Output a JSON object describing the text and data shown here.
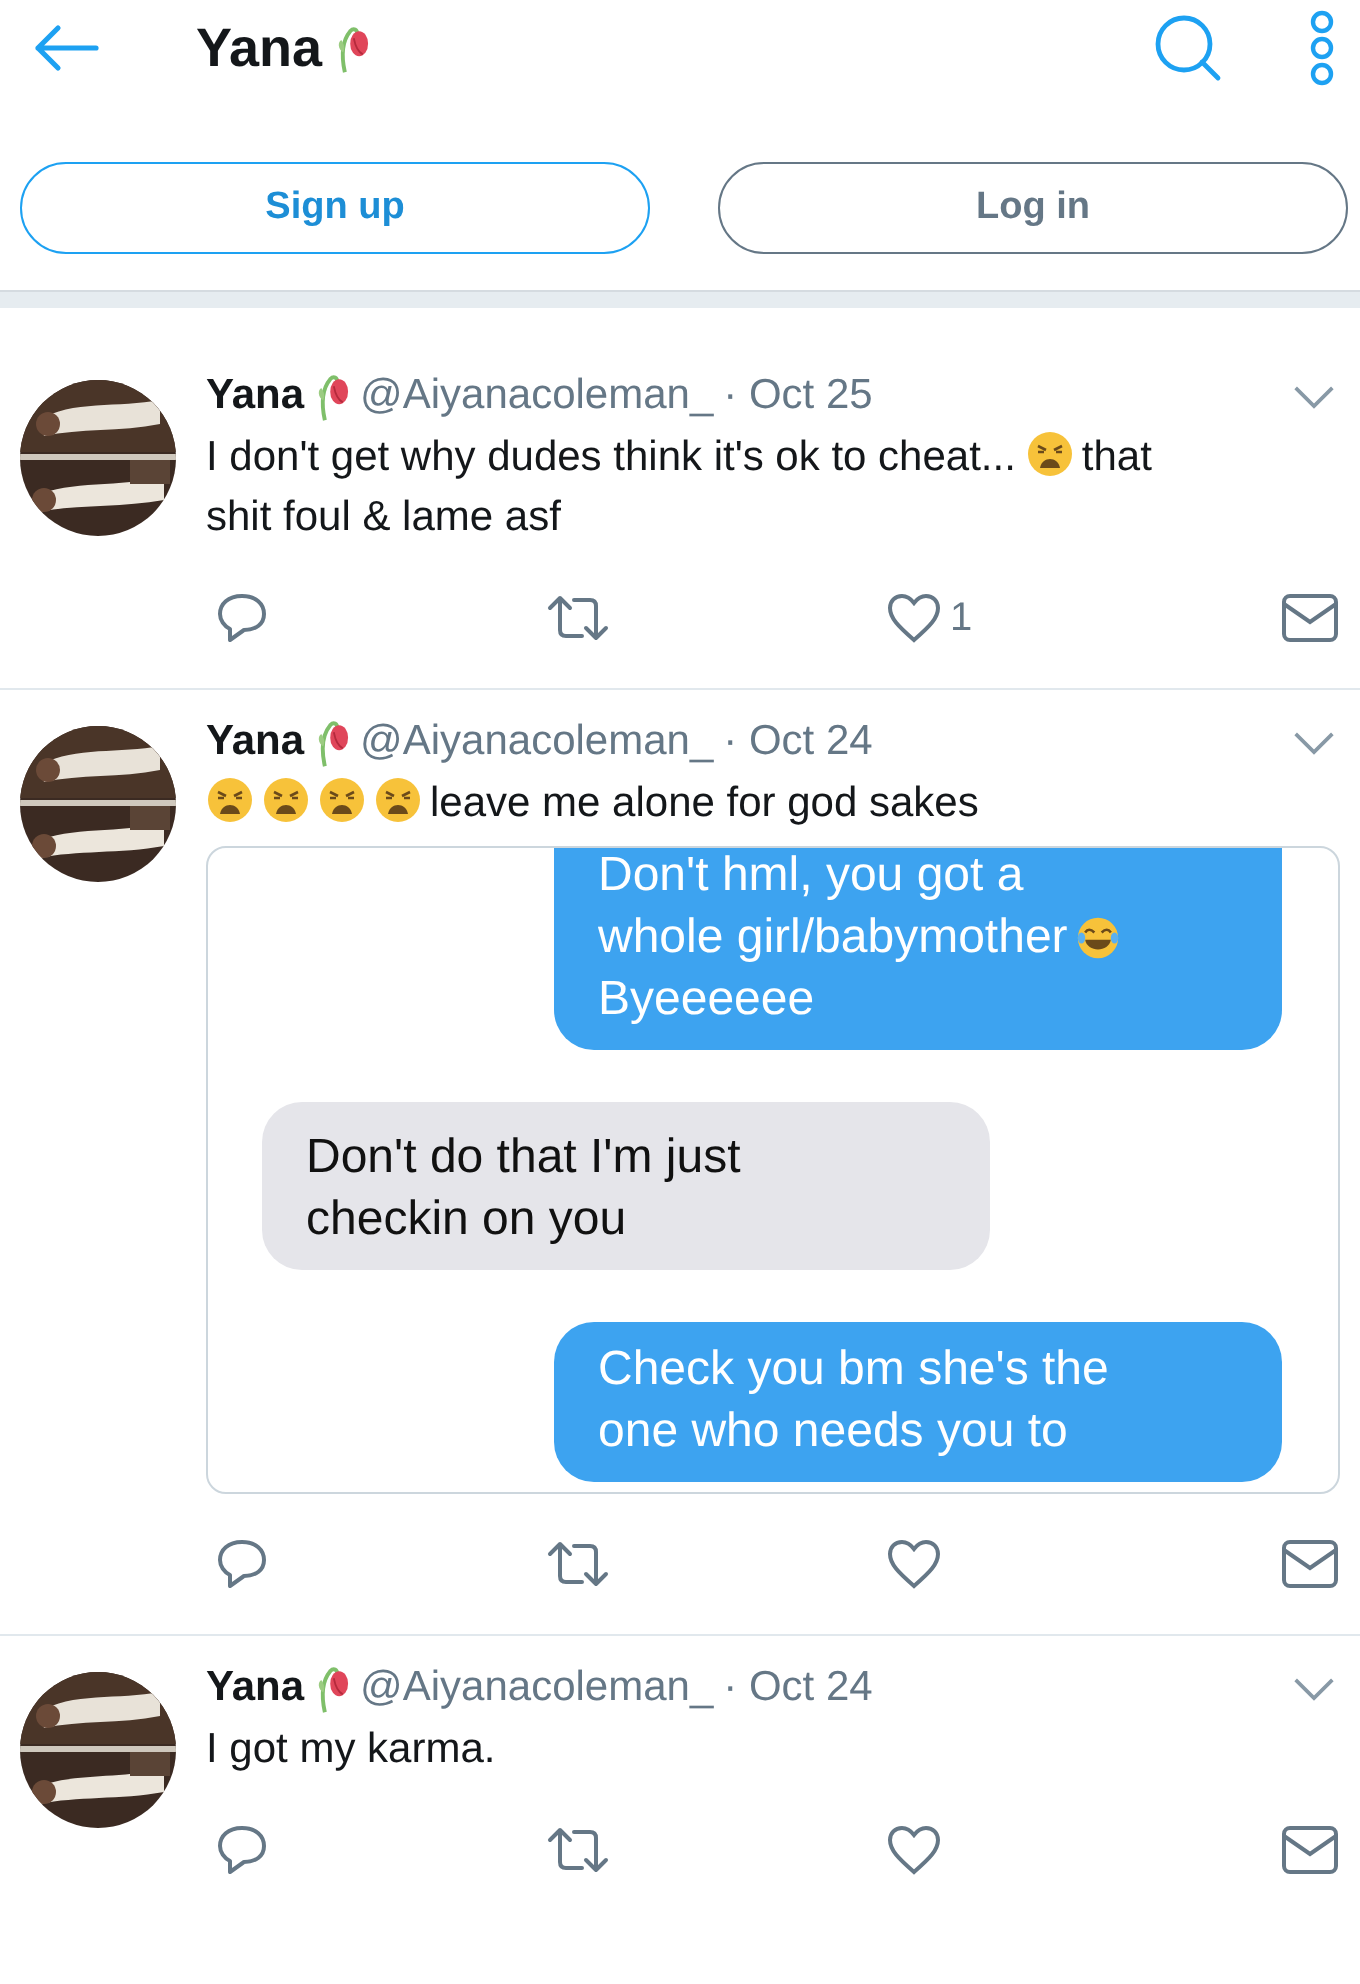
{
  "header": {
    "title": "Yana"
  },
  "buttons": [
    {
      "label": "Sign up",
      "kind": "primary"
    },
    {
      "label": "Log in",
      "kind": "secondary"
    }
  ],
  "tweets": [
    {
      "name": "Yana",
      "handle": "@Aiyanacoleman_",
      "date": "· Oct 25",
      "text": [
        {
          "kind": "text",
          "text": "I don't get why dudes think it's ok to cheat..."
        },
        {
          "kind": "weary"
        },
        {
          "kind": "text",
          "text": "that"
        },
        {
          "kind": "text",
          "text": "shit foul & lame asf"
        }
      ],
      "likes": "1"
    },
    {
      "name": "Yana",
      "handle": "@Aiyanacoleman_",
      "date": "· Oct 24",
      "text": [
        {
          "kind": "weary"
        },
        {
          "kind": "weary"
        },
        {
          "kind": "weary"
        },
        {
          "kind": "weary"
        },
        {
          "kind": "text",
          "text": "leave me alone for god sakes"
        }
      ],
      "media": {
        "messages": [
          {
            "kind": "sent",
            "lines": [
              [
                {
                  "kind": "text",
                  "text": "Don't hml, you got a"
                }
              ],
              [
                {
                  "kind": "text",
                  "text": "whole girl/babymother"
                },
                {
                  "kind": "joy"
                }
              ],
              [
                {
                  "kind": "text",
                  "text": "Byeeeeee"
                }
              ]
            ]
          },
          {
            "kind": "received",
            "lines": [
              [
                {
                  "kind": "text",
                  "text": "Don't do that I'm just"
                }
              ],
              [
                {
                  "kind": "text",
                  "text": "checkin on you"
                }
              ]
            ]
          },
          {
            "kind": "sent",
            "lines": [
              [
                {
                  "kind": "text",
                  "text": "Check you bm she's the"
                }
              ],
              [
                {
                  "kind": "text",
                  "text": "one who needs you to"
                }
              ]
            ]
          }
        ]
      }
    },
    {
      "name": "Yana",
      "handle": "@Aiyanacoleman_",
      "date": "· Oct 24",
      "text": [
        {
          "kind": "text",
          "text": "I got my karma."
        }
      ]
    }
  ]
}
